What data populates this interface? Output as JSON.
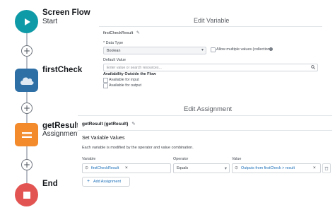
{
  "flow": {
    "nodes": [
      {
        "title": "Screen Flow",
        "subtitle": "Start"
      },
      {
        "title": "firstCheck",
        "subtitle": ""
      },
      {
        "title": "getResult",
        "subtitle": "Assignment"
      },
      {
        "title": "End",
        "subtitle": ""
      }
    ],
    "add_symbol": "+"
  },
  "edit_variable": {
    "title": "Edit Variable",
    "api_name": "firstCheckResult",
    "data_type_label": "* Data Type",
    "data_type_value": "Boolean",
    "allow_multiple_label": "Allow multiple values (collection)",
    "default_value_label": "Default Value",
    "default_value_placeholder": "Enter value or search resources...",
    "availability_heading": "Availability Outside the Flow",
    "available_input": "Available for input",
    "available_output": "Available for output"
  },
  "edit_assignment": {
    "title": "Edit Assignment",
    "name_display": "getResult (getResult)",
    "set_values_heading": "Set Variable Values",
    "description": "Each variable is modified by the operator and value combination.",
    "col_variable": "Variable",
    "col_operator": "Operator",
    "col_value": "Value",
    "row": {
      "variable": "firstCheckResult",
      "operator": "Equals",
      "value": "Outputs from firstCheck > result"
    },
    "add_assignment_label": "Add Assignment",
    "remove_symbol": "×"
  },
  "colors": {
    "start": "#0e9aa7",
    "action": "#2e6fa6",
    "assignment": "#f38a2b",
    "end": "#e25452",
    "link": "#1b6fb8"
  }
}
